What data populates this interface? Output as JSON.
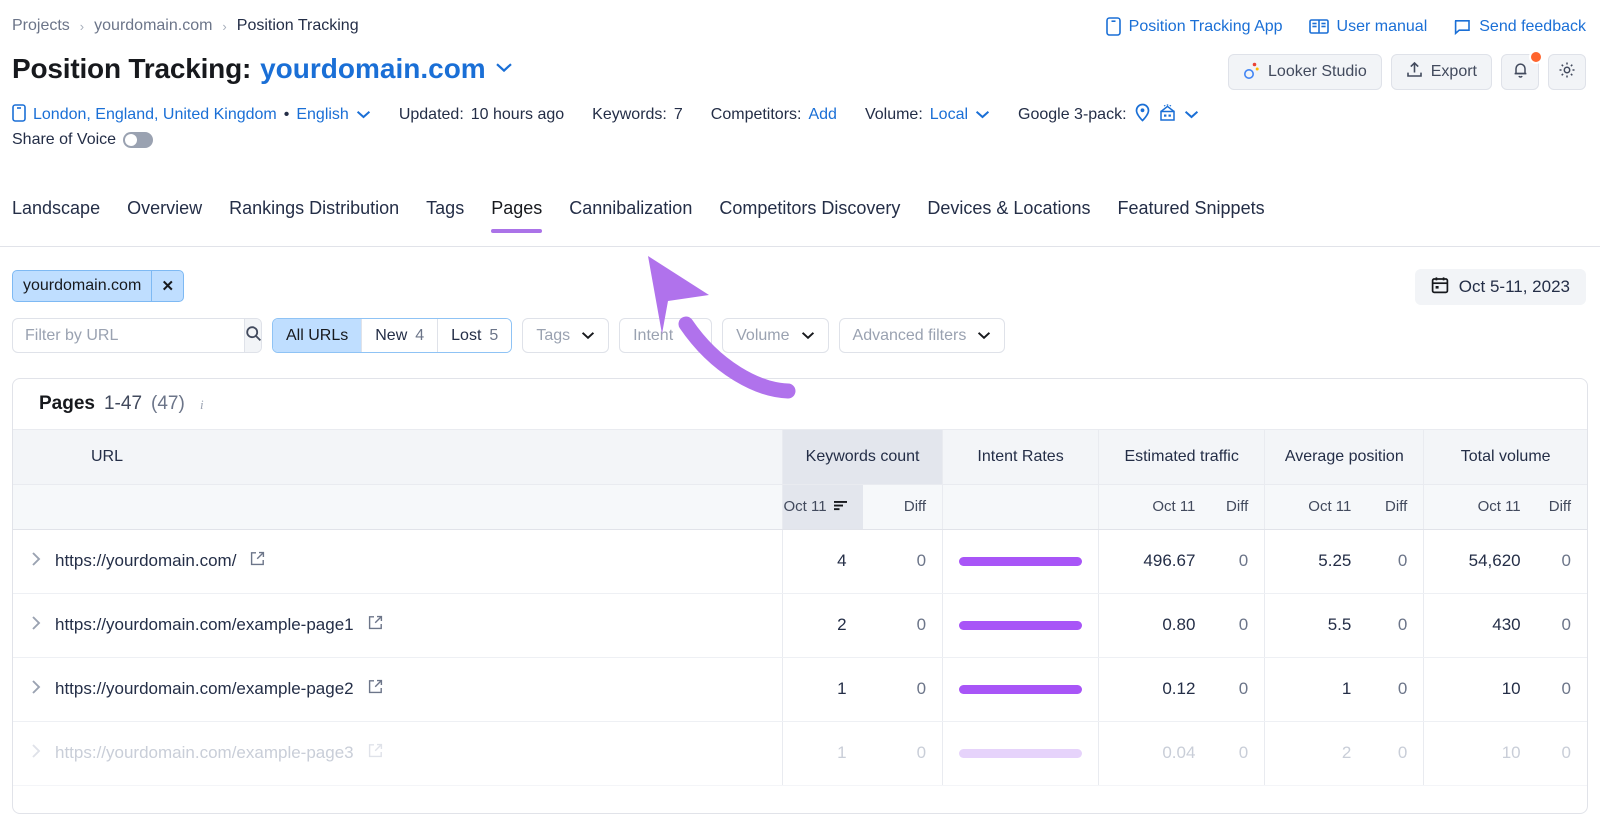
{
  "breadcrumb": {
    "items": [
      {
        "label": "Projects",
        "current": false
      },
      {
        "label": "yourdomain.com",
        "current": false
      },
      {
        "label": "Position Tracking",
        "current": true
      }
    ],
    "separator": "›"
  },
  "top_links": [
    {
      "label": "Position Tracking App",
      "icon": "mobile-app-icon"
    },
    {
      "label": "User manual",
      "icon": "book-icon"
    },
    {
      "label": "Send feedback",
      "icon": "chat-bubble-icon"
    }
  ],
  "header": {
    "title_static": "Position Tracking:",
    "title_domain": "yourdomain.com",
    "caret": "⌄"
  },
  "actions": {
    "looker_studio": "Looker Studio",
    "export": "Export",
    "notifications_icon": "bell-icon",
    "settings_icon": "gear-icon",
    "notification_dot_color": "#ff642d"
  },
  "meta": {
    "location": "London, England, United Kingdom",
    "separator": "•",
    "language": "English",
    "updated_label": "Updated:",
    "updated_value": "10 hours ago",
    "keywords_label": "Keywords:",
    "keywords_value": "7",
    "competitors_label": "Competitors:",
    "competitors_value": "Add",
    "volume_label": "Volume:",
    "volume_value": "Local",
    "google_pack_label": "Google 3-pack:",
    "share_of_voice_label": "Share of Voice"
  },
  "tabs": [
    {
      "label": "Landscape",
      "active": false
    },
    {
      "label": "Overview",
      "active": false
    },
    {
      "label": "Rankings Distribution",
      "active": false
    },
    {
      "label": "Tags",
      "active": false
    },
    {
      "label": "Pages",
      "active": true
    },
    {
      "label": "Cannibalization",
      "active": false
    },
    {
      "label": "Competitors Discovery",
      "active": false
    },
    {
      "label": "Devices & Locations",
      "active": false
    },
    {
      "label": "Featured Snippets",
      "active": false
    }
  ],
  "accent_color": "#ab73e8",
  "domain_chip": {
    "label": "yourdomain.com",
    "close": "✕"
  },
  "date_range": {
    "label": "Oct 5-11, 2023",
    "icon": "calendar-icon"
  },
  "filters": {
    "url_search_placeholder": "Filter by URL",
    "url_search_value": "",
    "segments": [
      {
        "label": "All URLs",
        "count": "",
        "active": true
      },
      {
        "label": "New",
        "count": "4",
        "active": false
      },
      {
        "label": "Lost",
        "count": "5",
        "active": false
      }
    ],
    "dropdowns": [
      {
        "label": "Tags"
      },
      {
        "label": "Intent"
      },
      {
        "label": "Volume"
      },
      {
        "label": "Advanced filters"
      }
    ]
  },
  "table": {
    "caption_strong": "Pages",
    "caption_range": "1-47",
    "caption_total": "(47)",
    "caption_info_icon": "info-icon",
    "columns": {
      "url": "URL",
      "keywords_count": "Keywords count",
      "intent_rates": "Intent Rates",
      "estimated_traffic": "Estimated traffic",
      "average_position": "Average position",
      "total_volume": "Total volume",
      "date_col": "Oct 11",
      "diff_col": "Diff",
      "sort_icon": "sort-descending-icon"
    },
    "rows": [
      {
        "url": "https://yourdomain.com/",
        "keywords_count": "4",
        "keywords_diff": "0",
        "intent_pct": 100,
        "estimated_traffic": "496.67",
        "traffic_diff": "0",
        "average_position": "5.25",
        "position_diff": "0",
        "total_volume": "54,620",
        "volume_diff": "0",
        "faded": false
      },
      {
        "url": "https://yourdomain.com/example-page1",
        "keywords_count": "2",
        "keywords_diff": "0",
        "intent_pct": 100,
        "estimated_traffic": "0.80",
        "traffic_diff": "0",
        "average_position": "5.5",
        "position_diff": "0",
        "total_volume": "430",
        "volume_diff": "0",
        "faded": false
      },
      {
        "url": "https://yourdomain.com/example-page2",
        "keywords_count": "1",
        "keywords_diff": "0",
        "intent_pct": 100,
        "estimated_traffic": "0.12",
        "traffic_diff": "0",
        "average_position": "1",
        "position_diff": "0",
        "total_volume": "10",
        "volume_diff": "0",
        "faded": false
      },
      {
        "url": "https://yourdomain.com/example-page3",
        "keywords_count": "1",
        "keywords_diff": "0",
        "intent_pct": 100,
        "estimated_traffic": "0.04",
        "traffic_diff": "0",
        "average_position": "2",
        "position_diff": "0",
        "total_volume": "10",
        "volume_diff": "0",
        "faded": true
      }
    ]
  },
  "annotation": {
    "arrow_color": "#b072ec",
    "target": "Pages tab"
  }
}
